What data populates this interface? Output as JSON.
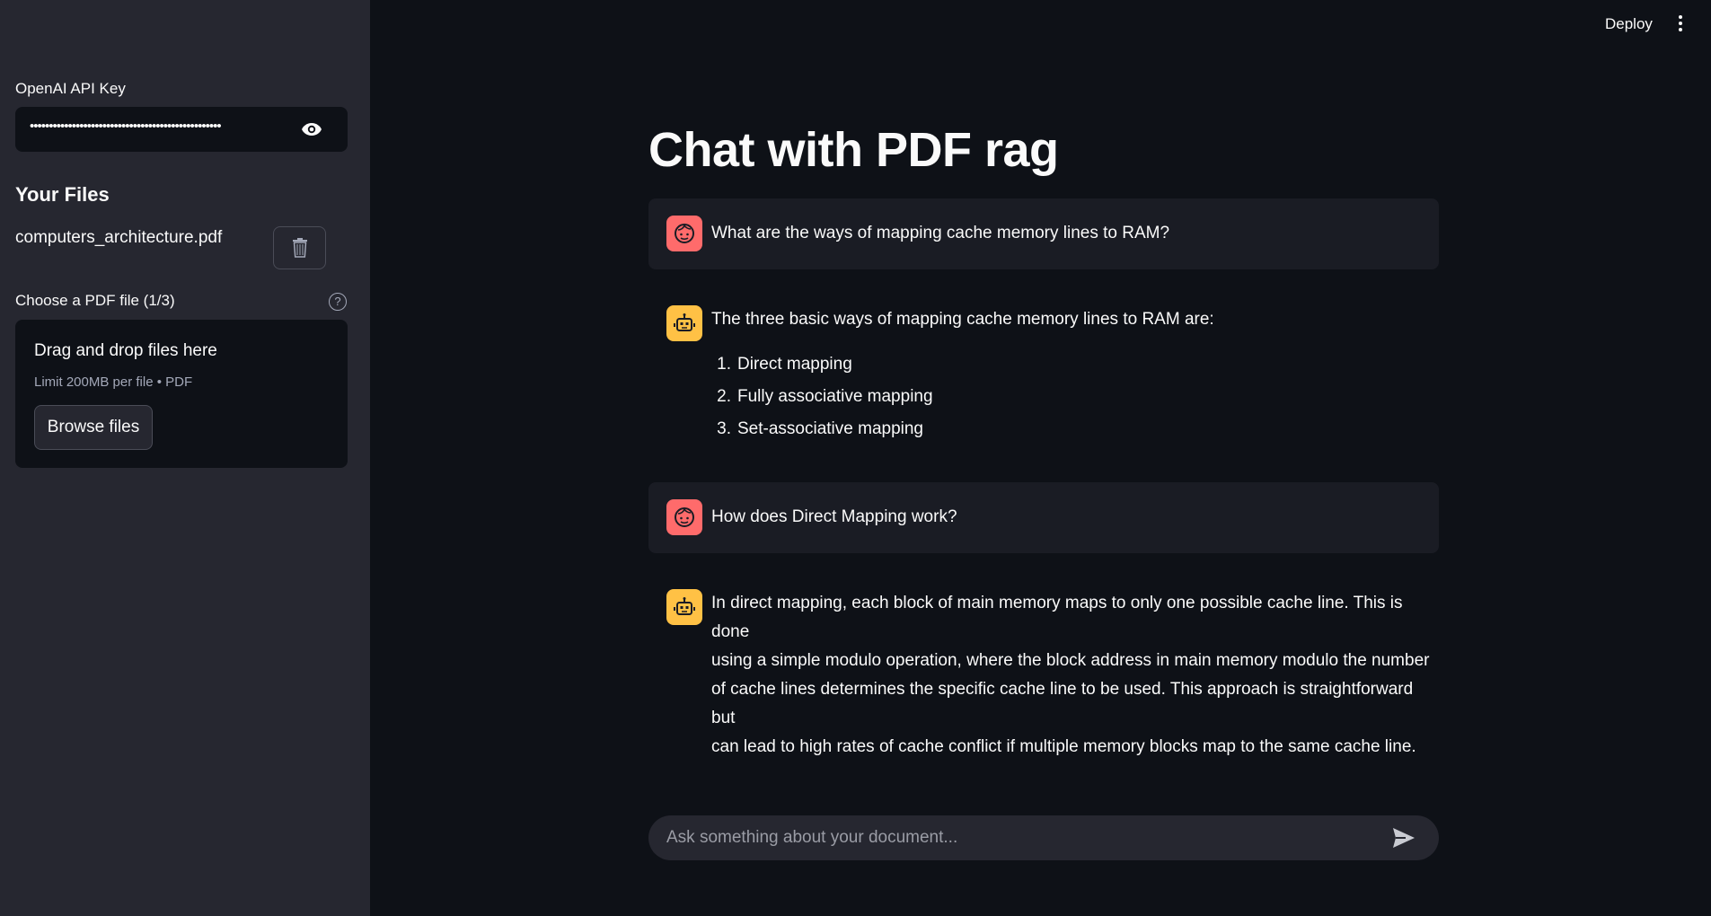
{
  "sidebar": {
    "api_key_label": "OpenAI API Key",
    "api_key_value": "••••••••••••••••••••••••••••••••••••••••••••••••••",
    "files_heading": "Your Files",
    "file_name": "computers_architecture.pdf",
    "uploader_label": "Choose a PDF file (1/3)",
    "help_glyph": "?",
    "dropzone_title": "Drag and drop files here",
    "dropzone_limit": "Limit 200MB per file • PDF",
    "browse_label": "Browse files"
  },
  "topbar": {
    "deploy_label": "Deploy"
  },
  "main": {
    "title": "Chat with PDF rag",
    "messages": [
      {
        "role": "user",
        "text": "What are the ways of mapping cache memory lines to RAM?"
      },
      {
        "role": "assistant",
        "intro": "The three basic ways of mapping cache memory lines to RAM are:",
        "list": [
          {
            "num": "1.",
            "text": "Direct mapping"
          },
          {
            "num": "2.",
            "text": "Fully associative mapping"
          },
          {
            "num": "3.",
            "text": "Set-associative mapping"
          }
        ]
      },
      {
        "role": "user",
        "text": "How does Direct Mapping work?"
      },
      {
        "role": "assistant",
        "lines": [
          "In direct mapping, each block of main memory maps to only one possible cache line. This is done",
          "using a simple modulo operation, where the block address in main memory modulo the number",
          "of cache lines determines the specific cache line to be used. This approach is straightforward but",
          "can lead to high rates of cache conflict if multiple memory blocks map to the same cache line."
        ]
      }
    ]
  },
  "chat_input": {
    "placeholder": "Ask something about your document..."
  },
  "colors": {
    "user_avatar": "#ff6b6b",
    "bot_avatar": "#ffc145",
    "background": "#0e1117",
    "sidebar": "#262730"
  },
  "icons": [
    "eye-icon",
    "trash-icon",
    "help-icon",
    "user-avatar-icon",
    "robot-avatar-icon",
    "send-icon",
    "kebab-menu-icon"
  ]
}
